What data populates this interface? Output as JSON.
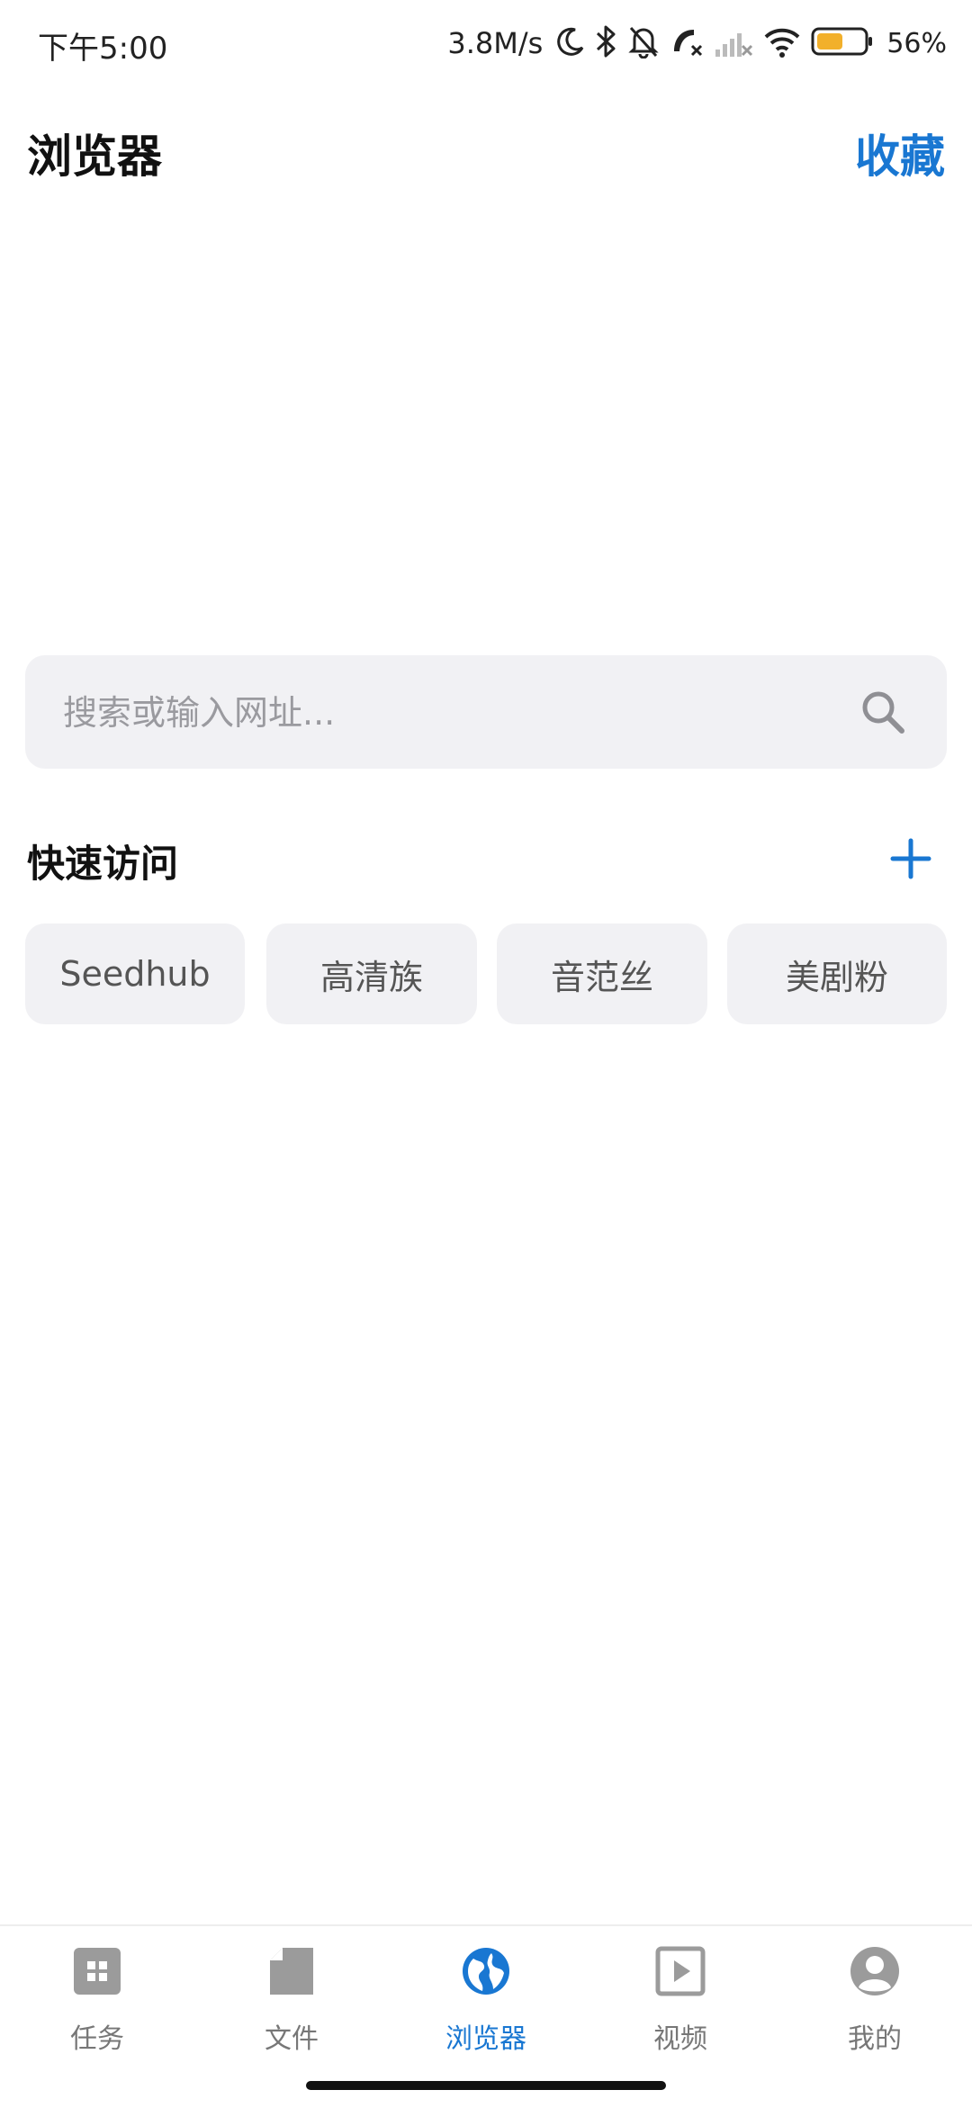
{
  "status_bar": {
    "time": "下午5:00",
    "speed": "3.8M/s",
    "battery_percent": "56%",
    "icons": [
      "moon-icon",
      "bluetooth-icon",
      "mute-bell-icon",
      "call-missed-icon",
      "no-signal-icon",
      "wifi-icon",
      "battery-icon"
    ],
    "battery_level": 0.56,
    "battery_color": "#f2b02b"
  },
  "header": {
    "title": "浏览器",
    "action": "收藏"
  },
  "search": {
    "placeholder": "搜索或输入网址..."
  },
  "quick_access": {
    "title": "快速访问",
    "items": [
      {
        "label": "Seedhub"
      },
      {
        "label": "高清族"
      },
      {
        "label": "音范丝"
      },
      {
        "label": "美剧粉"
      }
    ]
  },
  "bottom_nav": {
    "items": [
      {
        "label": "任务",
        "icon": "tasks-icon"
      },
      {
        "label": "文件",
        "icon": "file-icon"
      },
      {
        "label": "浏览器",
        "icon": "globe-icon",
        "active": true
      },
      {
        "label": "视频",
        "icon": "video-icon"
      },
      {
        "label": "我的",
        "icon": "profile-icon"
      }
    ]
  },
  "colors": {
    "accent": "#1977d2",
    "chip_bg": "#f1f1f4",
    "icon_gray": "#9b9b9b"
  }
}
